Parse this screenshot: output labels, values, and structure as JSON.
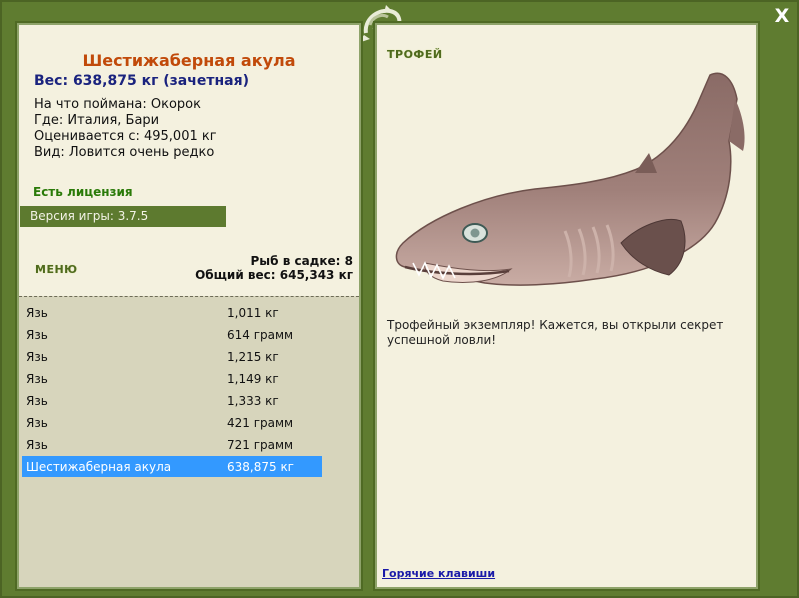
{
  "window": {
    "close_label": "X"
  },
  "fish": {
    "title": "Шестижаберная акула",
    "weight": "Вес: 638,875 кг (зачетная)",
    "bait": "На что поймана: Окорок",
    "location": "Где: Италия, Бари",
    "value": "Оценивается с: 495,001 кг",
    "rarity": "Вид: Ловится очень редко"
  },
  "license": "Есть лицензия",
  "version": "Версия игры: 3.7.5",
  "menu_label": "МЕНЮ",
  "cage": {
    "count": "Рыб в садке: 8",
    "total": "Общий вес: 645,343 кг"
  },
  "catch_list": [
    {
      "name": "Язь",
      "weight": "1,011 кг"
    },
    {
      "name": "Язь",
      "weight": "614 грамм"
    },
    {
      "name": "Язь",
      "weight": "1,215 кг"
    },
    {
      "name": "Язь",
      "weight": "1,149 кг"
    },
    {
      "name": "Язь",
      "weight": "1,333 кг"
    },
    {
      "name": "Язь",
      "weight": "421 грамм"
    },
    {
      "name": "Язь",
      "weight": "721 грамм"
    },
    {
      "name": "Шестижаберная акула",
      "weight": "638,875 кг"
    }
  ],
  "trophy": {
    "label": "ТРОФЕЙ",
    "text": "Трофейный экземпляр! Кажется, вы открыли секрет успешной ловли!"
  },
  "hotkeys_label": "Горячие клавиши",
  "colors": {
    "frame": "#5f7c30",
    "panel": "#f4f1df",
    "selected": "#3399ff",
    "title": "#c14a0a"
  }
}
